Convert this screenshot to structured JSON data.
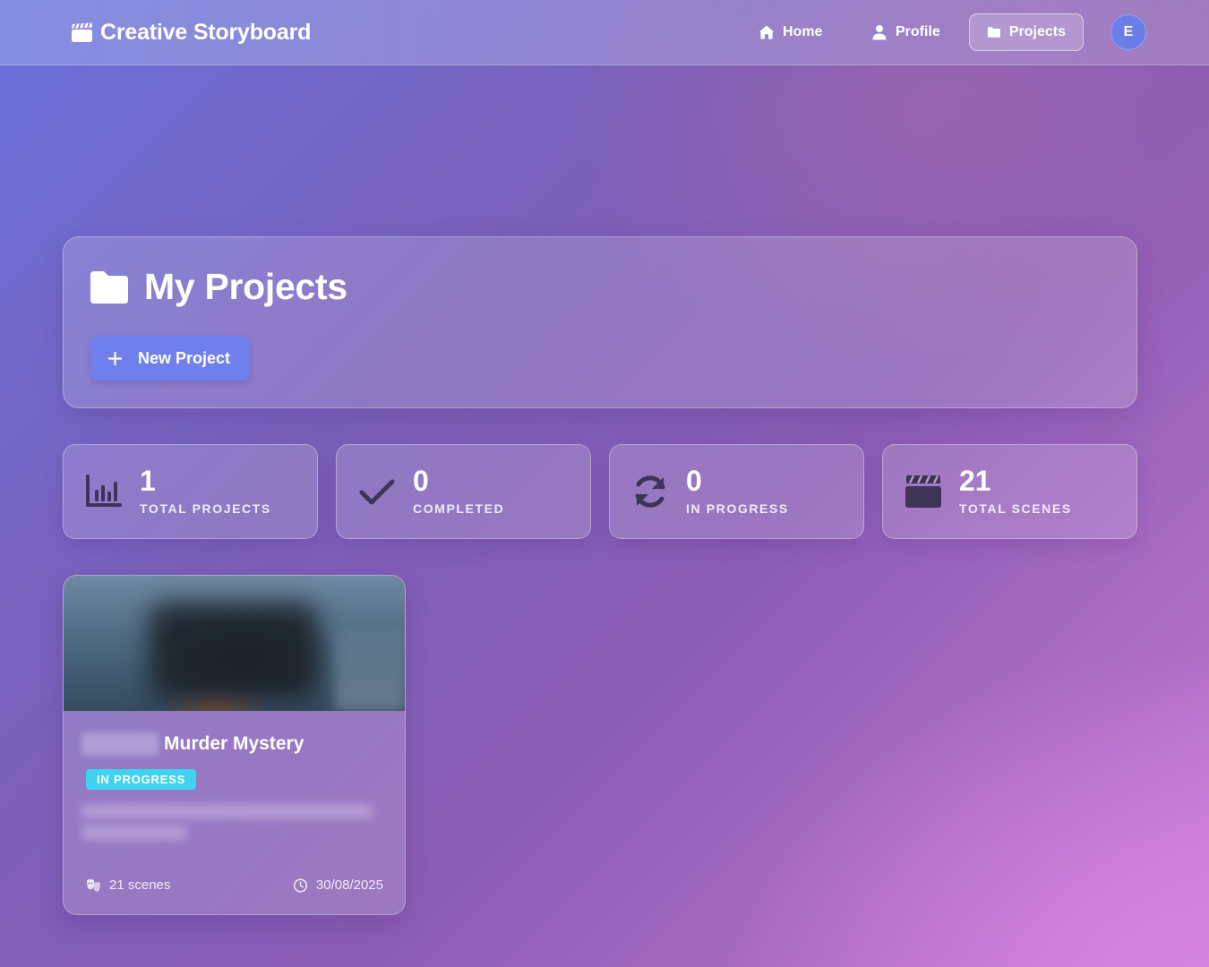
{
  "navbar": {
    "brand": "Creative Storyboard",
    "links": {
      "home": "Home",
      "profile": "Profile",
      "projects": "Projects"
    },
    "avatar_initial": "E"
  },
  "header": {
    "title": "My Projects",
    "new_project_label": "New Project"
  },
  "stats": [
    {
      "value": "1",
      "label": "TOTAL PROJECTS",
      "icon": "chart-bar-icon"
    },
    {
      "value": "0",
      "label": "COMPLETED",
      "icon": "check-icon"
    },
    {
      "value": "0",
      "label": "IN PROGRESS",
      "icon": "sync-icon"
    },
    {
      "value": "21",
      "label": "TOTAL SCENES",
      "icon": "clapperboard-icon"
    }
  ],
  "projects": [
    {
      "title": "Murder Mystery",
      "status": "IN PROGRESS",
      "scenes": "21 scenes",
      "date": "30/08/2025"
    }
  ],
  "colors": {
    "accent_button": "#6f80ec",
    "status_in_progress": "#3fd3f0",
    "avatar": "#6b7ee8",
    "stat_icon": "#3d3458"
  }
}
